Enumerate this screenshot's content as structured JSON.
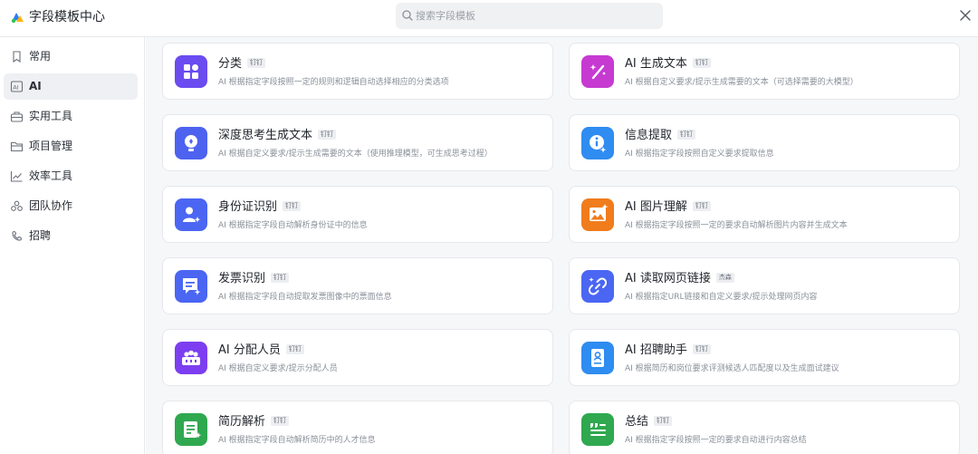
{
  "header": {
    "title": "字段模板中心",
    "search_placeholder": "搜索字段模板",
    "search_value": ""
  },
  "sidebar": {
    "items": [
      {
        "label": "常用",
        "icon": "bookmark-icon",
        "active": false
      },
      {
        "label": "AI",
        "icon": "ai-icon",
        "active": true
      },
      {
        "label": "实用工具",
        "icon": "toolbox-icon",
        "active": false
      },
      {
        "label": "项目管理",
        "icon": "folder-icon",
        "active": false
      },
      {
        "label": "效率工具",
        "icon": "trend-icon",
        "active": false
      },
      {
        "label": "团队协作",
        "icon": "team-icon",
        "active": false
      },
      {
        "label": "招聘",
        "icon": "recruit-icon",
        "active": false
      }
    ]
  },
  "templates": [
    {
      "title": "分类",
      "badge": "钉钉",
      "desc": "AI 根据指定字段按照一定的规则和逻辑自动选择相应的分类选项",
      "icon": "category-icon",
      "color": "#6a4cf0"
    },
    {
      "title": "AI 生成文本",
      "badge": "钉钉",
      "desc": "AI 根据自定义要求/提示生成需要的文本（可选择需要的大模型）",
      "icon": "magic-wand-icon",
      "color": "#c63ad2"
    },
    {
      "title": "深度思考生成文本",
      "badge": "钉钉",
      "desc": "AI 根据自定义要求/提示生成需要的文本（使用推理模型，可生成思考过程）",
      "icon": "lightbulb-icon",
      "color": "#4d63f0"
    },
    {
      "title": "信息提取",
      "badge": "钉钉",
      "desc": "AI 根据指定字段按照自定义要求提取信息",
      "icon": "info-icon",
      "color": "#2f8cf0"
    },
    {
      "title": "身份证识别",
      "badge": "钉钉",
      "desc": "AI 根据指定字段自动解析身份证中的信息",
      "icon": "id-card-icon",
      "color": "#4a66f2"
    },
    {
      "title": "AI 图片理解",
      "badge": "钉钉",
      "desc": "AI 根据指定字段按照一定的要求自动解析图片内容并生成文本",
      "icon": "image-icon",
      "color": "#f07c1c"
    },
    {
      "title": "发票识别",
      "badge": "钉钉",
      "desc": "AI 根据指定字段自动提取发票图像中的票面信息",
      "icon": "invoice-icon",
      "color": "#4a66f2"
    },
    {
      "title": "AI 读取网页链接",
      "badge": "杰森",
      "desc": "AI 根据指定URL链接和自定义要求/提示处理网页内容",
      "icon": "link-icon",
      "color": "#4a66f2"
    },
    {
      "title": "AI 分配人员",
      "badge": "钉钉",
      "desc": "AI 根据自定义要求/提示分配人员",
      "icon": "assign-people-icon",
      "color": "#7c3ef0"
    },
    {
      "title": "AI 招聘助手",
      "badge": "钉钉",
      "desc": "AI 根据简历和岗位要求评测候选人匹配度以及生成面试建议",
      "icon": "recruit-assistant-icon",
      "color": "#2f8cf0"
    },
    {
      "title": "简历解析",
      "badge": "钉钉",
      "desc": "AI 根据指定字段自动解析简历中的人才信息",
      "icon": "resume-icon",
      "color": "#2fa84f"
    },
    {
      "title": "总结",
      "badge": "钉钉",
      "desc": "AI 根据指定字段按照一定的要求自动进行内容总结",
      "icon": "summary-icon",
      "color": "#2fa84f"
    }
  ]
}
